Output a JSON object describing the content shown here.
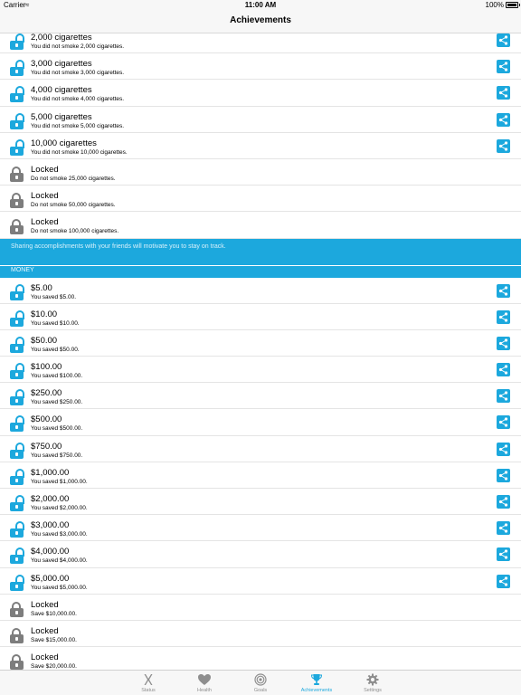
{
  "status_bar": {
    "carrier": "Carrier",
    "time": "11:00 AM",
    "battery": "100%"
  },
  "nav": {
    "title": "Achievements"
  },
  "colors": {
    "accent": "#1ca8dd",
    "locked": "#7d7d7d",
    "tab_inactive": "#8e8e8e"
  },
  "cigarettes": [
    {
      "title": "2,000 cigarettes",
      "subtitle": "You did not smoke 2,000 cigarettes.",
      "unlocked": true
    },
    {
      "title": "3,000 cigarettes",
      "subtitle": "You did not smoke 3,000 cigarettes.",
      "unlocked": true
    },
    {
      "title": "4,000 cigarettes",
      "subtitle": "You did not smoke 4,000 cigarettes.",
      "unlocked": true
    },
    {
      "title": "5,000 cigarettes",
      "subtitle": "You did not smoke 5,000 cigarettes.",
      "unlocked": true
    },
    {
      "title": "10,000 cigarettes",
      "subtitle": "You did not smoke 10,000 cigarettes.",
      "unlocked": true
    },
    {
      "title": "Locked",
      "subtitle": "Do not smoke 25,000 cigarettes.",
      "unlocked": false
    },
    {
      "title": "Locked",
      "subtitle": "Do not smoke 50,000 cigarettes.",
      "unlocked": false
    },
    {
      "title": "Locked",
      "subtitle": "Do not smoke 100,000 cigarettes.",
      "unlocked": false
    }
  ],
  "info_banner": "Sharing accomplishments with your friends will motivate you to stay on track.",
  "money_header": "MONEY",
  "money": [
    {
      "title": "$5.00",
      "subtitle": "You saved $5.00.",
      "unlocked": true
    },
    {
      "title": "$10.00",
      "subtitle": "You saved $10.00.",
      "unlocked": true
    },
    {
      "title": "$50.00",
      "subtitle": "You saved $50.00.",
      "unlocked": true
    },
    {
      "title": "$100.00",
      "subtitle": "You saved $100.00.",
      "unlocked": true
    },
    {
      "title": "$250.00",
      "subtitle": "You saved $250.00.",
      "unlocked": true
    },
    {
      "title": "$500.00",
      "subtitle": "You saved $500.00.",
      "unlocked": true
    },
    {
      "title": "$750.00",
      "subtitle": "You saved $750.00.",
      "unlocked": true
    },
    {
      "title": "$1,000.00",
      "subtitle": "You saved $1,000.00.",
      "unlocked": true
    },
    {
      "title": "$2,000.00",
      "subtitle": "You saved $2,000.00.",
      "unlocked": true
    },
    {
      "title": "$3,000.00",
      "subtitle": "You saved $3,000.00.",
      "unlocked": true
    },
    {
      "title": "$4,000.00",
      "subtitle": "You saved $4,000.00.",
      "unlocked": true
    },
    {
      "title": "$5,000.00",
      "subtitle": "You saved $5,000.00.",
      "unlocked": true
    },
    {
      "title": "Locked",
      "subtitle": "Save $10,000.00.",
      "unlocked": false
    },
    {
      "title": "Locked",
      "subtitle": "Save $15,000.00.",
      "unlocked": false
    },
    {
      "title": "Locked",
      "subtitle": "Save $20,000.00.",
      "unlocked": false
    }
  ],
  "tabs": [
    {
      "label": "Status",
      "icon": "x-icon",
      "active": false
    },
    {
      "label": "Health",
      "icon": "heart-icon",
      "active": false
    },
    {
      "label": "Goals",
      "icon": "target-icon",
      "active": false
    },
    {
      "label": "Achievements",
      "icon": "trophy-icon",
      "active": true
    },
    {
      "label": "Settings",
      "icon": "gear-icon",
      "active": false
    }
  ]
}
